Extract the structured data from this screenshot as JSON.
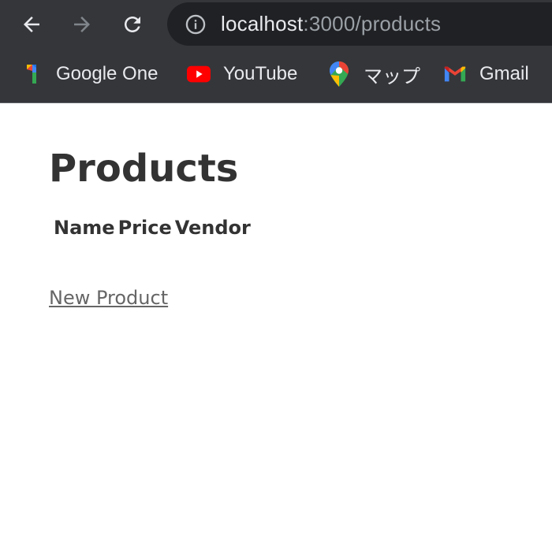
{
  "browser": {
    "url": {
      "host": "localhost",
      "path": ":3000/products"
    },
    "bookmarks": [
      {
        "label": "Google One",
        "icon": "google-one-icon"
      },
      {
        "label": "YouTube",
        "icon": "youtube-icon"
      },
      {
        "label": "マップ",
        "icon": "google-maps-icon"
      },
      {
        "label": "Gmail",
        "icon": "gmail-icon"
      }
    ],
    "colors": {
      "chrome_background": "#35363a",
      "omnibox_background": "#202124"
    }
  },
  "page": {
    "title": "Products",
    "table": {
      "headers": [
        "Name",
        "Price",
        "Vendor"
      ]
    },
    "new_link": "New Product"
  }
}
